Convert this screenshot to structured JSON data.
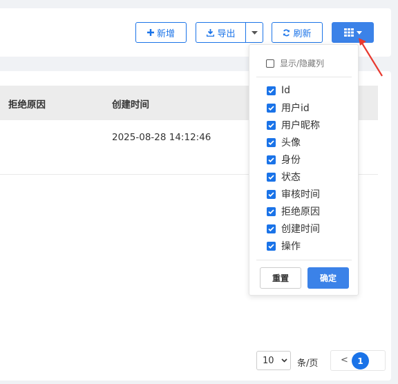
{
  "toolbar": {
    "add_label": "新增",
    "export_label": "导出",
    "refresh_label": "刷新"
  },
  "table": {
    "headers": [
      "拒绝原因",
      "创建时间"
    ],
    "rows": [
      {
        "created_at": "2025-08-28 14:12:46"
      }
    ]
  },
  "column_popup": {
    "toggle_label": "显示/隐藏列",
    "columns": [
      {
        "label": "Id",
        "checked": true
      },
      {
        "label": "用户id",
        "checked": true
      },
      {
        "label": "用户昵称",
        "checked": true
      },
      {
        "label": "头像",
        "checked": true
      },
      {
        "label": "身份",
        "checked": true
      },
      {
        "label": "状态",
        "checked": true
      },
      {
        "label": "审核时间",
        "checked": true
      },
      {
        "label": "拒绝原因",
        "checked": true
      },
      {
        "label": "创建时间",
        "checked": true
      },
      {
        "label": "操作",
        "checked": true
      }
    ],
    "reset_label": "重置",
    "confirm_label": "确定"
  },
  "pagination": {
    "page_size": "10",
    "per_page_label": "条/页",
    "prev_symbol": "<",
    "current_page": "1"
  },
  "colors": {
    "accent": "#1a73e8",
    "primary_button": "#3b82e8",
    "arrow": "#e8392f"
  }
}
